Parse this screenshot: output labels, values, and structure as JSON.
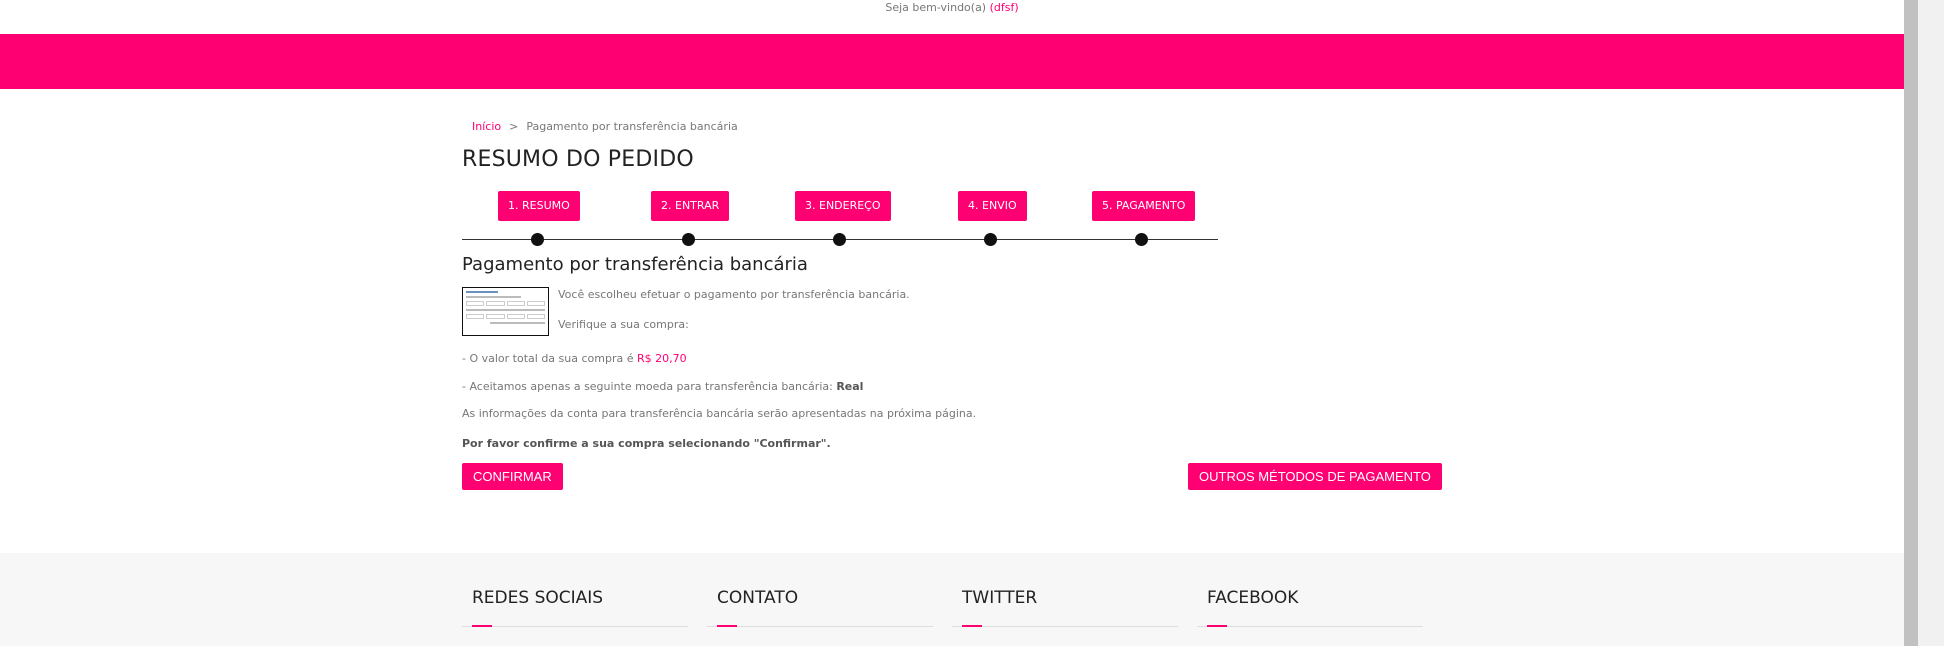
{
  "header": {
    "welcome_text": "Seja bem-vindo(a)",
    "username": "(dfsf)"
  },
  "breadcrumb": {
    "home": "Início",
    "separator": ">",
    "current": "Pagamento por transferência bancária"
  },
  "page_title": "RESUMO DO PEDIDO",
  "steps": [
    {
      "label": "1. RESUMO"
    },
    {
      "label": "2. ENTRAR"
    },
    {
      "label": "3. ENDEREÇO"
    },
    {
      "label": "4. ENVIO"
    },
    {
      "label": "5. PAGAMENTO"
    }
  ],
  "payment": {
    "title": "Pagamento por transferência bancária",
    "chosen_text": "Você escolheu efetuar o pagamento por transferência bancária.",
    "verify_text": "Verifique a sua compra:",
    "total_prefix": "- O valor total da sua compra é",
    "total_value": "R$ 20,70",
    "currency_prefix": "- Aceitamos apenas a seguinte moeda para transferência bancária:",
    "currency_value": "Real",
    "account_info": "As informações da conta para transferência bancária serão apresentadas na próxima página.",
    "confirm_note": "Por favor confirme a sua compra selecionando \"Confirmar\"."
  },
  "buttons": {
    "confirm": "CONFIRMAR",
    "other_methods": "OUTROS MÉTODOS DE PAGAMENTO"
  },
  "footer": {
    "columns": [
      {
        "title": "REDES SOCIAIS"
      },
      {
        "title": "CONTATO"
      },
      {
        "title": "TWITTER"
      },
      {
        "title": "FACEBOOK"
      }
    ]
  },
  "colors": {
    "accent": "#ff0072",
    "text": "#777777",
    "heading": "#222222",
    "footer_bg": "#f7f7f7"
  }
}
